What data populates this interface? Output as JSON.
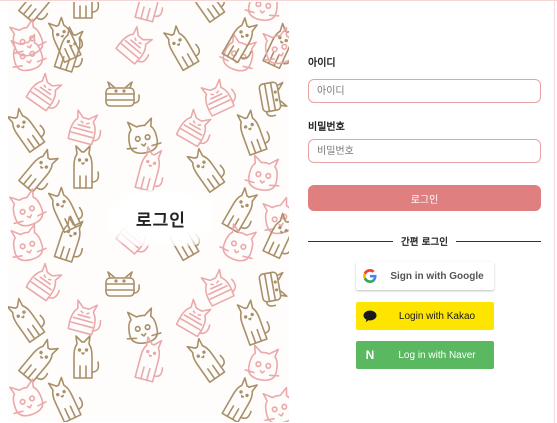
{
  "hero": {
    "title": "로그인",
    "pattern_colors": {
      "pink": "#eaa9ab",
      "brown": "#a8906a"
    }
  },
  "form": {
    "id_label": "아이디",
    "id_placeholder": "아이디",
    "password_label": "비밀번호",
    "password_placeholder": "비밀번호",
    "login_button": "로그인",
    "divider_text": "간편 로그인"
  },
  "social": {
    "google_label": "Sign in with Google",
    "kakao_label": "Login with Kakao",
    "naver_label": "Log in with Naver",
    "naver_icon_letter": "N"
  },
  "colors": {
    "accent": "#e07f80",
    "input_border": "#e7a3a3",
    "kakao": "#fee500",
    "naver": "#5ab860"
  }
}
